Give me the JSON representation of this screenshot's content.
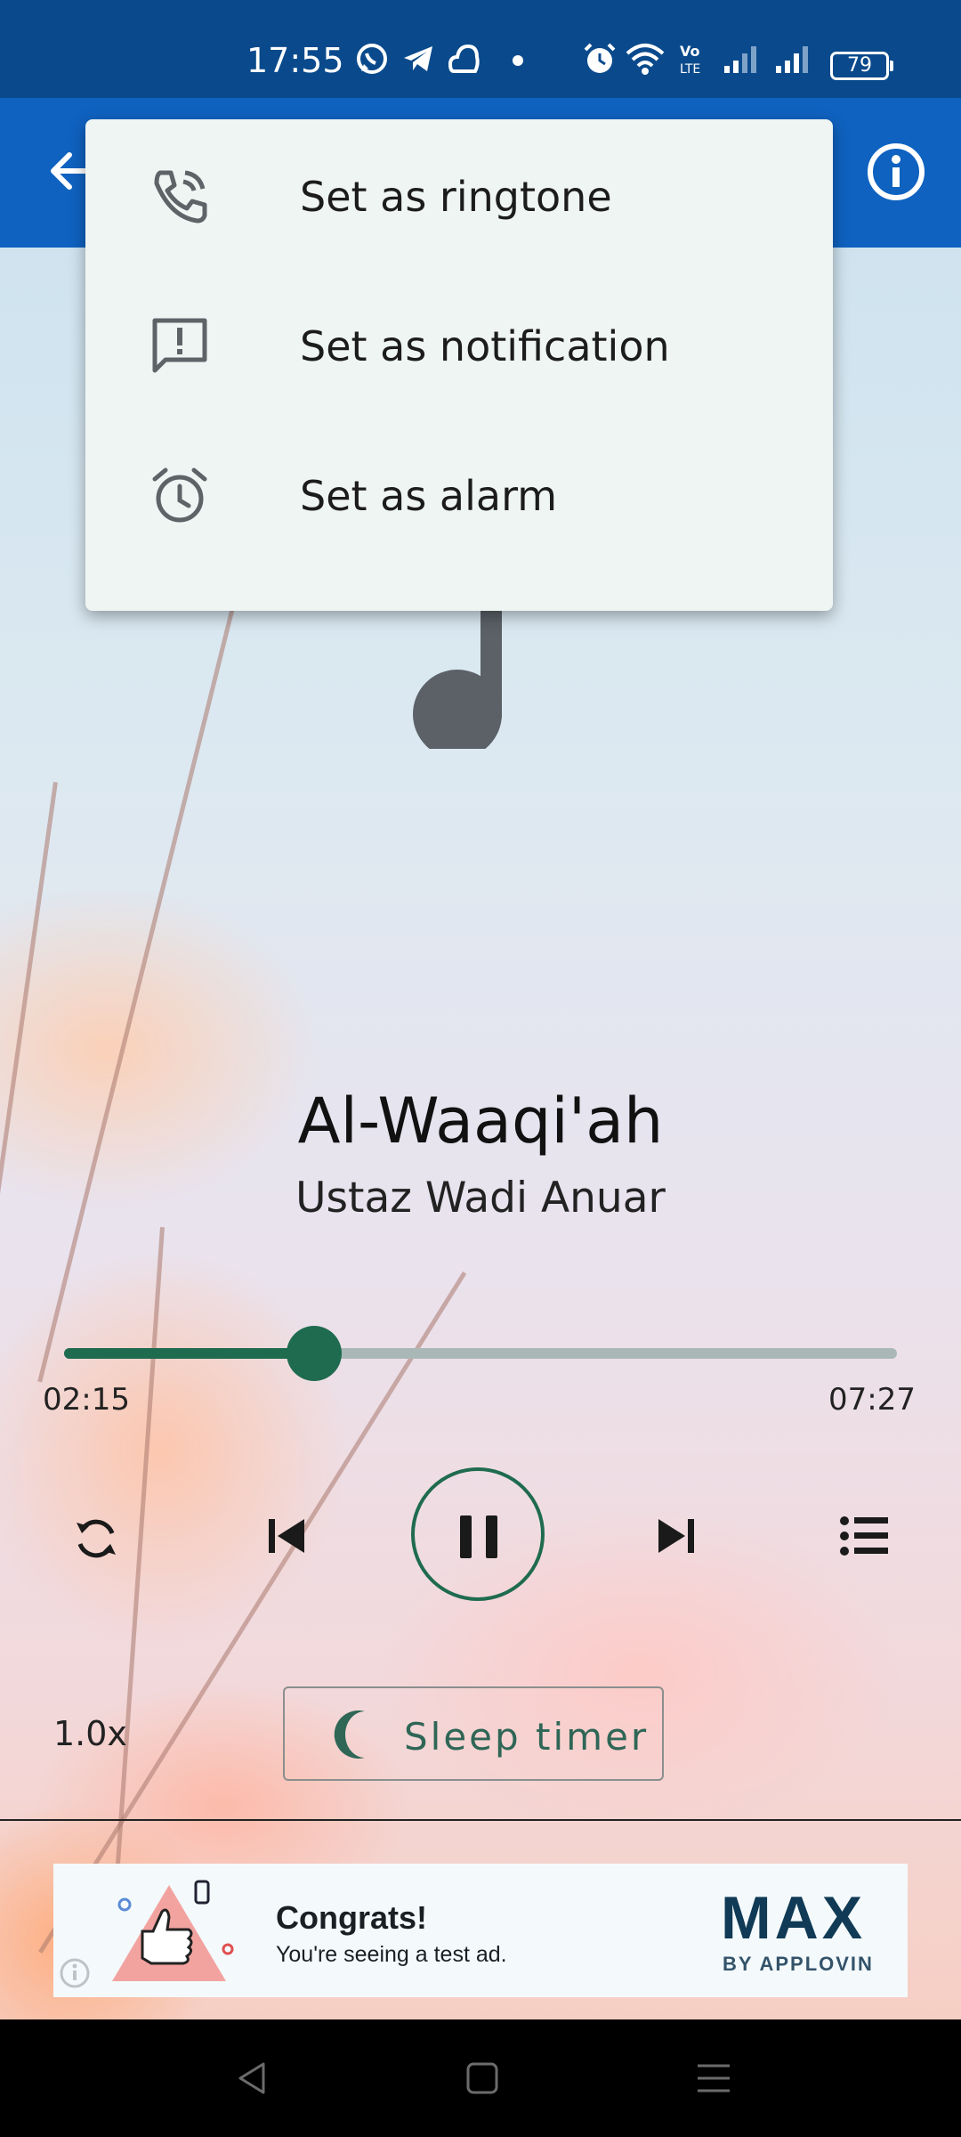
{
  "status_bar": {
    "time": "17:55",
    "battery": "79",
    "icons": [
      "whatsapp-icon",
      "telegram-icon",
      "cloud-icon",
      "dot-icon",
      "alarm-icon",
      "wifi-icon",
      "volte-icon",
      "signal-icon",
      "signal-icon"
    ]
  },
  "app_bar": {
    "back_icon": "arrow-back-icon",
    "info_icon": "info-icon",
    "color": "#0f62c0"
  },
  "menu": {
    "items": [
      {
        "label": "Set as ringtone",
        "icon": "phone-ring-icon"
      },
      {
        "label": "Set as notification",
        "icon": "notification-icon"
      },
      {
        "label": "Set as alarm",
        "icon": "alarm-icon"
      }
    ]
  },
  "player": {
    "title": "Al-Waaqi'ah",
    "artist": "Ustaz Wadi Anuar",
    "elapsed": "02:15",
    "total": "07:27",
    "progress_fraction": 0.3,
    "speed": "1.0x",
    "sleep_timer_label": "Sleep timer",
    "accent_color": "#1f6b4f"
  },
  "ad": {
    "title": "Congrats!",
    "subtitle": "You're seeing a test ad.",
    "brand": "MAX",
    "brand_sub": "BY APPLOVIN"
  }
}
